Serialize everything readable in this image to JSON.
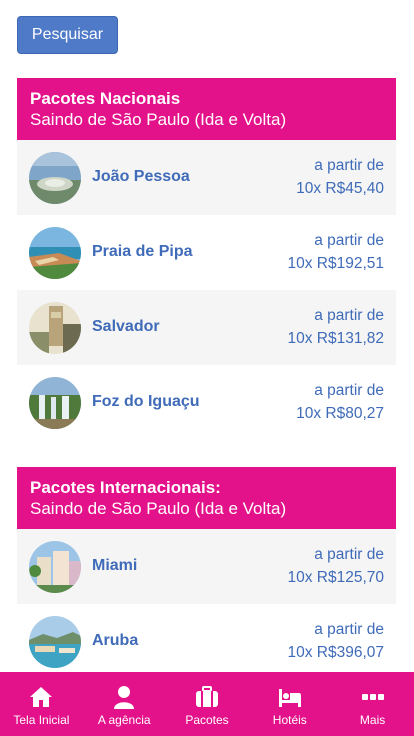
{
  "search": {
    "label": "Pesquisar"
  },
  "colors": {
    "brand_pink": "#e3128b",
    "link_blue": "#3f6bb8",
    "button_blue": "#4e7ac8"
  },
  "national": {
    "title": "Pacotes Nacionais",
    "subtitle": "Saindo de São Paulo (Ida e Volta)",
    "items": [
      {
        "name": "João Pessoa",
        "from_label": "a partir de",
        "price": "10x R$45,40",
        "icon": "joao-pessoa-photo"
      },
      {
        "name": "Praia de Pipa",
        "from_label": "a partir de",
        "price": "10x R$192,51",
        "icon": "praia-de-pipa-photo"
      },
      {
        "name": "Salvador",
        "from_label": "a partir de",
        "price": "10x R$131,82",
        "icon": "salvador-photo"
      },
      {
        "name": "Foz do Iguaçu",
        "from_label": "a partir de",
        "price": "10x R$80,27",
        "icon": "foz-do-iguacu-photo"
      }
    ]
  },
  "international": {
    "title": "Pacotes Internacionais:",
    "subtitle": "Saindo de São Paulo (Ida e Volta)",
    "items": [
      {
        "name": "Miami",
        "from_label": "a partir de",
        "price": "10x R$125,70",
        "icon": "miami-photo"
      },
      {
        "name": "Aruba",
        "from_label": "a partir de",
        "price": "10x R$396,07",
        "icon": "aruba-photo"
      }
    ]
  },
  "nav": {
    "items": [
      {
        "label": "Tela Inicial",
        "icon": "home-icon"
      },
      {
        "label": "A agência",
        "icon": "user-icon"
      },
      {
        "label": "Pacotes",
        "icon": "suitcase-icon"
      },
      {
        "label": "Hotéis",
        "icon": "bed-icon"
      },
      {
        "label": "Mais",
        "icon": "more-icon"
      }
    ]
  }
}
